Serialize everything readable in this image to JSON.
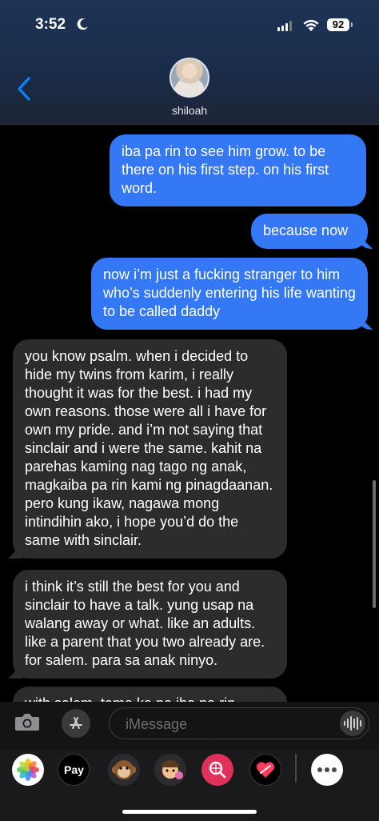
{
  "status_bar": {
    "time": "3:52",
    "battery": "92"
  },
  "header": {
    "contact_name": "shiloah"
  },
  "messages": [
    {
      "type": "sent",
      "text": "iba pa rin to see him grow. to be there on his first step. on his first word."
    },
    {
      "type": "sent",
      "text": "because now"
    },
    {
      "type": "sent",
      "text": "now i’m just a fucking stranger to him who’s suddenly entering his life wanting to be called daddy"
    },
    {
      "type": "received",
      "text": "you know psalm. when i decided to hide my twins from karim, i really thought it was for the best. i had my own reasons. those were all i have for own my pride. and i’m not saying that sinclair and i were the same. kahit na parehas kaming nag tago ng anak, magkaiba pa rin kami ng pinagdaanan. pero kung ikaw, nagawa mong intindihin ako, i hope you’d do the same with sinclair."
    },
    {
      "type": "received",
      "text": "i think it’s still the best for you and sinclair to have a talk. yung usap na walang away or what. like an adults. like a parent that you two already are. for salem. para sa anak ninyo."
    },
    {
      "type": "received",
      "text": "with salem. tama ka na iba pa rin"
    }
  ],
  "compose": {
    "placeholder": "iMessage"
  },
  "app_drawer": {
    "apple_pay_label": "Pay"
  },
  "colors": {
    "sent_bubble": "#3478f6",
    "received_bubble": "#2c2c2e",
    "accent": "#0a84ff"
  }
}
